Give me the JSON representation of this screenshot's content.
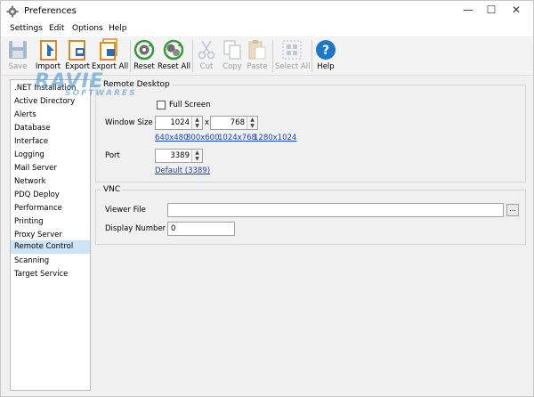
{
  "window": {
    "title": "Preferences",
    "minimize": "—",
    "maximize": "☐",
    "close": "✕"
  },
  "menu": [
    "Settings",
    "Edit",
    "Options",
    "Help"
  ],
  "toolbar": {
    "save": "Save",
    "import": "Import",
    "export": "Export",
    "export_all": "Export All",
    "reset": "Reset",
    "reset_all": "Reset All",
    "cut": "Cut",
    "copy": "Copy",
    "paste": "Paste",
    "select_all": "Select All",
    "help": "Help"
  },
  "sidebar": {
    "items": [
      ".NET Installation",
      "Active Directory",
      "Alerts",
      "Database",
      "Interface",
      "Logging",
      "Mail Server",
      "Network",
      "PDQ Deploy",
      "Performance",
      "Printing",
      "Proxy Server",
      "Remote Control",
      "Scanning",
      "Target Service"
    ],
    "selected": "Remote Control"
  },
  "remote_desktop": {
    "title": "Remote Desktop",
    "full_screen_label": "Full Screen",
    "window_size_label": "Window Size",
    "width": "1024",
    "x_sep": "x",
    "height": "768",
    "presets": [
      "640x480",
      "800x600",
      "1024x768",
      "1280x1024"
    ],
    "port_label": "Port",
    "port": "3389",
    "default_link": "Default (3389)"
  },
  "vnc": {
    "title": "VNC",
    "viewer_file_label": "Viewer File",
    "viewer_file": "",
    "browse": "...",
    "display_number_label": "Display Number",
    "display_number": "0"
  },
  "watermark": {
    "main": "RAVIE",
    "sub": "SOFTWARES"
  },
  "colors": {
    "selection": "#cce4f7",
    "link": "#1a3fbf",
    "help_icon": "#1e78c8",
    "accent_orange": "#e08a1e"
  }
}
